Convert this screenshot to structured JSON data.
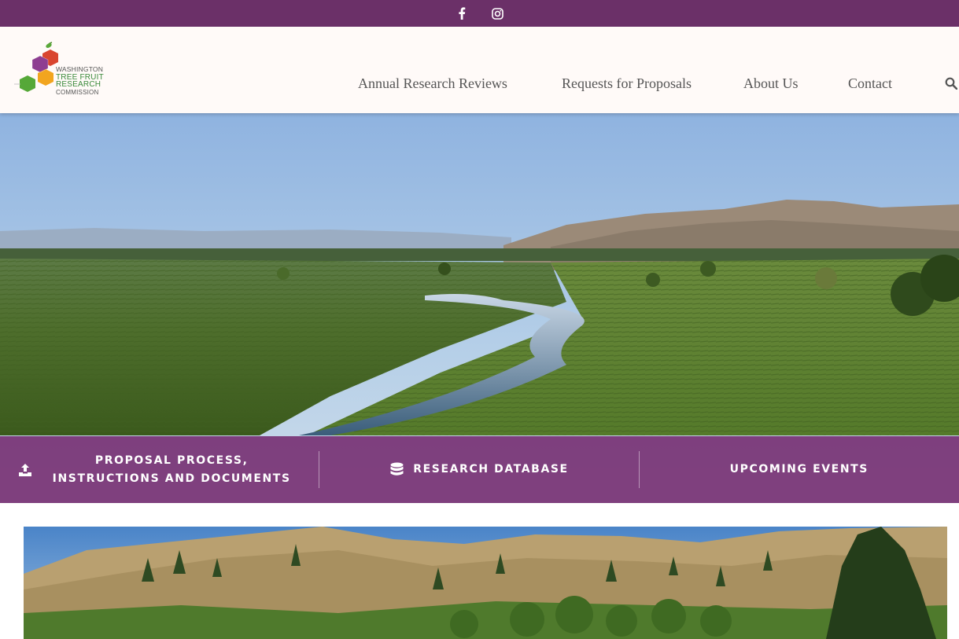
{
  "topbar": {
    "bg": "#6b3068",
    "icons": [
      "facebook-icon",
      "instagram-icon"
    ]
  },
  "header": {
    "logo": {
      "line1": "WASHINGTON",
      "line2": "TREE FRUIT",
      "line3": "RESEARCH",
      "line4": "COMMISSION"
    },
    "nav": [
      {
        "label": "Annual Research Reviews"
      },
      {
        "label": "Requests for Proposals"
      },
      {
        "label": "About Us"
      },
      {
        "label": "Contact"
      }
    ],
    "search_icon": "search-icon"
  },
  "hero": {
    "description_icon_upload": "upload-icon",
    "description_icon_db": "database-icon"
  },
  "actions": {
    "proposal": "PROPOSAL PROCESS, INSTRUCTIONS AND DOCUMENTS",
    "database": "RESEARCH DATABASE",
    "events": "UPCOMING EVENTS",
    "band_color": "#742a6e"
  },
  "colors": {
    "accent": "#6b3068",
    "nav_text": "#555555",
    "header_bg": "#fffaf8"
  }
}
